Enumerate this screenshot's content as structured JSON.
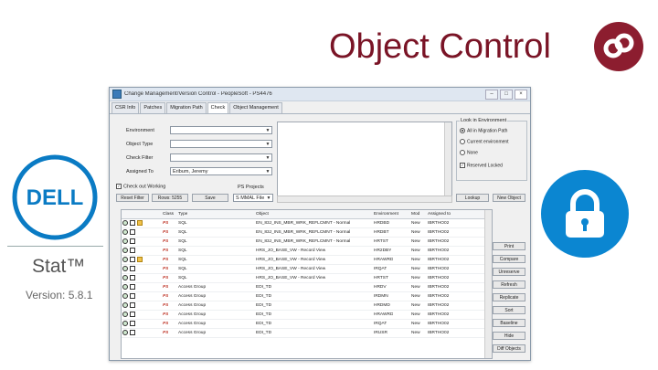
{
  "slide": {
    "title": "Object Control",
    "product_name": "Stat™",
    "product_version": "Version: 5.8.1",
    "dell_logo_text": "DELL",
    "title_color": "#7a1426",
    "lock_color": "#0b86d1"
  },
  "window": {
    "title": "Change Management/Version Control - PeopleSoft - PS4476",
    "tabs": [
      "CSR Info",
      "Patches",
      "Migration Path",
      "Check",
      "Object Management"
    ],
    "active_tab": 3,
    "filters": {
      "environment_label": "Environment",
      "environment_value": "",
      "object_type_label": "Object Type",
      "object_type_value": "",
      "check_filter_label": "Check Filter",
      "check_filter_value": "",
      "assigned_to_label": "Assigned To",
      "assigned_to_value": "Eribum, Jeremy"
    },
    "checkout_working_label": "Check out Working",
    "ps_projects_label": "PS Projects",
    "buttons": {
      "reset_filter": "Reset Filter",
      "rows_sum": "Rows: 5255",
      "save": "Save",
      "project_select": "S MMAL File",
      "new_object": "New Object",
      "lookup": "Lookup"
    },
    "look_in": {
      "title": "Look in Environment",
      "options": [
        "All in Migration Path",
        "Current environment",
        "None"
      ],
      "selected": 0,
      "checkbox_label": "Reserved Locked"
    },
    "side_buttons": [
      "Print",
      "Compare",
      "Unreserve",
      "Refresh",
      "Replicate",
      "Sort",
      "Baseline",
      "Hide",
      "Diff Objects"
    ],
    "grid": {
      "columns": [
        "Class",
        "Type",
        "Object",
        "Environment",
        "Mod",
        "Assigned to"
      ],
      "rows": [
        {
          "class": "PS",
          "type": "SQL",
          "object": "EN_83J_INS_MBR_WRK_REFLCMNT - Normal",
          "env": "HRDBD",
          "mod": "New",
          "assigned": "IBRTHO02",
          "folder": true
        },
        {
          "class": "PS",
          "type": "SQL",
          "object": "EN_83J_INS_MBR_WRK_REFLCMNT - Normal",
          "env": "HRDBT",
          "mod": "New",
          "assigned": "IBRTHO02",
          "folder": false
        },
        {
          "class": "PS",
          "type": "SQL",
          "object": "EN_83J_INS_MBR_WRK_REFLCMNT - Normal",
          "env": "HRTST",
          "mod": "New",
          "assigned": "IBRTHO02",
          "folder": false
        },
        {
          "class": "PS",
          "type": "SQL",
          "object": "HRS_JO_BASE_VW - Record View",
          "env": "HR2DBY",
          "mod": "New",
          "assigned": "IBRTHO02",
          "folder": false
        },
        {
          "class": "PS",
          "type": "SQL",
          "object": "HRS_JO_BASE_VW - Record View",
          "env": "HRAWRD",
          "mod": "New",
          "assigned": "IBRTHO02",
          "folder": true
        },
        {
          "class": "PS",
          "type": "SQL",
          "object": "HRS_JO_BASE_VW - Record View",
          "env": "IRQAT",
          "mod": "New",
          "assigned": "IBRTHO02",
          "folder": false
        },
        {
          "class": "PS",
          "type": "SQL",
          "object": "HRS_JO_BASE_VW - Record View",
          "env": "HRTST",
          "mod": "New",
          "assigned": "IBRTHO02",
          "folder": false
        },
        {
          "class": "PS",
          "type": "Access Group",
          "object": "EDI_TD",
          "env": "HRDV",
          "mod": "New",
          "assigned": "IBRTHO02",
          "folder": false
        },
        {
          "class": "PS",
          "type": "Access Group",
          "object": "EDI_TD",
          "env": "IRDMN",
          "mod": "New",
          "assigned": "IBRTHO02",
          "folder": false
        },
        {
          "class": "PS",
          "type": "Access Group",
          "object": "EDI_TD",
          "env": "HRDMD",
          "mod": "New",
          "assigned": "IBRTHO02",
          "folder": false
        },
        {
          "class": "PS",
          "type": "Access Group",
          "object": "EDI_TD",
          "env": "HRAWRD",
          "mod": "New",
          "assigned": "IBRTHO02",
          "folder": false
        },
        {
          "class": "PS",
          "type": "Access Group",
          "object": "EDI_TD",
          "env": "IRQAT",
          "mod": "New",
          "assigned": "IBRTHO02",
          "folder": false
        },
        {
          "class": "PS",
          "type": "Access Group",
          "object": "EDI_TD",
          "env": "IRUSR",
          "mod": "New",
          "assigned": "IBRTHO02",
          "folder": false
        }
      ]
    }
  }
}
